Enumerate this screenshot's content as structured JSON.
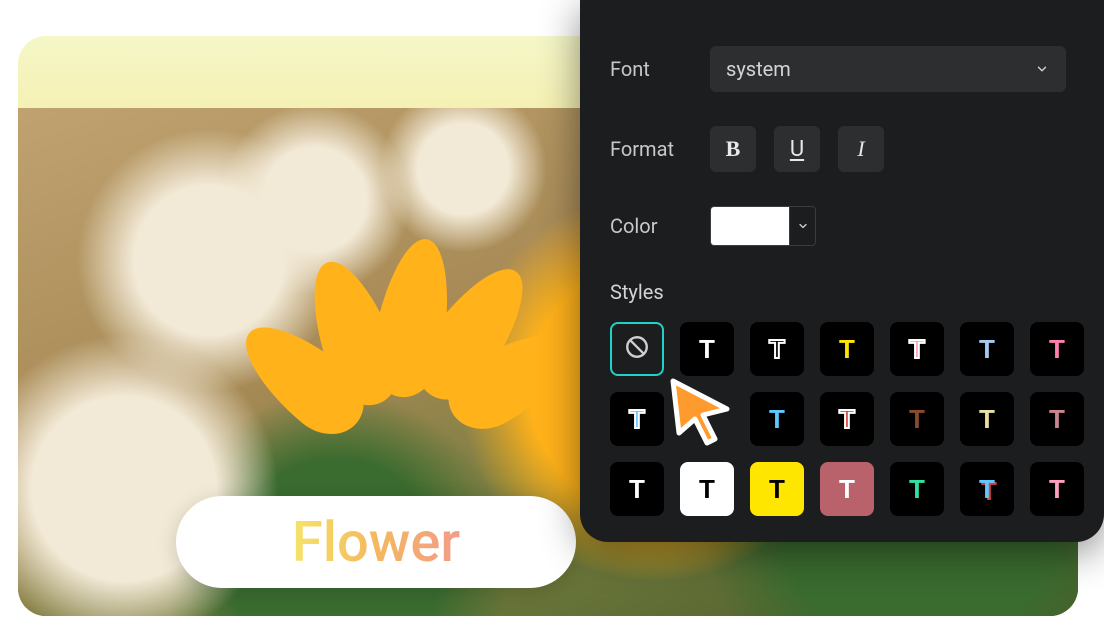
{
  "canvas": {
    "text_overlay": "Flower"
  },
  "panel": {
    "font": {
      "label": "Font",
      "value": "system"
    },
    "format": {
      "label": "Format",
      "bold": "B",
      "underline": "U",
      "italic": "I"
    },
    "color": {
      "label": "Color",
      "value": "#ffffff"
    },
    "styles": {
      "label": "Styles",
      "items": [
        {
          "id": "none",
          "selected": true
        },
        {
          "id": "white-solid",
          "fill": "#ffffff",
          "bg": "#000000"
        },
        {
          "id": "white-outline",
          "stroke": "#ffffff",
          "bg": "#000000"
        },
        {
          "id": "yellow",
          "fill": "#ffe600",
          "bg": "#000000"
        },
        {
          "id": "pink-out",
          "fill": "#ff9fae",
          "stroke": "#ffffff",
          "bg": "#000000"
        },
        {
          "id": "light-blue",
          "fill": "#a9c8ef",
          "bg": "#000000"
        },
        {
          "id": "pink-gradient",
          "fill": "#ff7fb0",
          "bg": "#000000"
        },
        {
          "id": "sky-out",
          "fill": "#5ec8ff",
          "stroke": "#ffffff",
          "bg": "#000000"
        },
        {
          "id": "cursor-gap"
        },
        {
          "id": "cyan",
          "fill": "#5ec8ff",
          "bg": "#000000"
        },
        {
          "id": "red-out",
          "fill": "#d8443a",
          "stroke": "#ffffff",
          "bg": "#000000"
        },
        {
          "id": "brown",
          "fill": "#8a4a2e",
          "bg": "#000000"
        },
        {
          "id": "cream",
          "fill": "#e8dfa0",
          "bg": "#000000"
        },
        {
          "id": "rose",
          "fill": "#c9868e",
          "bg": "#000000"
        },
        {
          "id": "white-on-black",
          "fill": "#ffffff",
          "bg": "#000000"
        },
        {
          "id": "black-on-white",
          "fill": "#000000",
          "bg": "#ffffff"
        },
        {
          "id": "black-on-yellow",
          "fill": "#000000",
          "bg": "#ffe600"
        },
        {
          "id": "white-on-rose",
          "fill": "#ffffff",
          "bg": "#b9626b"
        },
        {
          "id": "green",
          "fill": "#2fe2a0",
          "bg": "#000000"
        },
        {
          "id": "blue-red",
          "fill": "#5ec8ff",
          "shadow": "#d8443a",
          "bg": "#000000"
        },
        {
          "id": "pink-plain",
          "fill": "#ff9fc0",
          "bg": "#000000"
        }
      ]
    }
  }
}
